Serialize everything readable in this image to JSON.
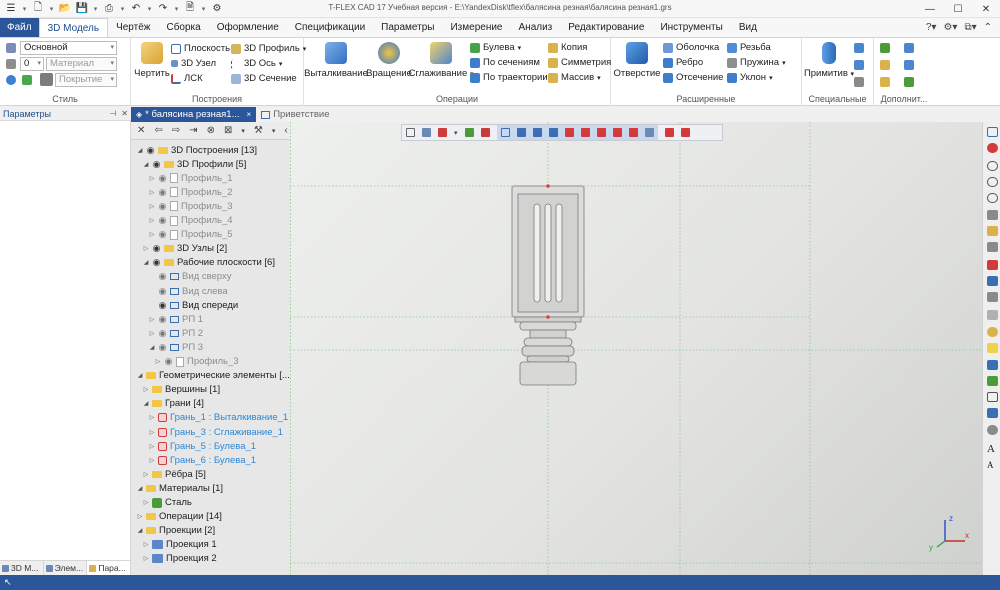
{
  "window": {
    "title": "T-FLEX CAD 17 Учебная версия - E:\\YandexDisk\\tflex\\балясина резная\\балясина резная1.grs",
    "minimize_icon": "minimize-icon",
    "maximize_icon": "maximize-icon",
    "close_icon": "close-icon"
  },
  "quick_access": [
    "menu-icon",
    "new-icon",
    "open-icon",
    "save-icon",
    "print-icon",
    "undo-icon",
    "redo-icon",
    "document-icon",
    "settings-icon"
  ],
  "menu": {
    "file": "Файл",
    "tabs": [
      "3D Модель",
      "Чертёж",
      "Сборка",
      "Оформление",
      "Спецификации",
      "Параметры",
      "Измерение",
      "Анализ",
      "Редактирование",
      "Инструменты",
      "Вид"
    ],
    "active_tab": "3D Модель",
    "right_icons": [
      "help-icon",
      "settings-icon",
      "windows-icon",
      "minimize-ribbon-icon"
    ]
  },
  "ribbon": {
    "style_group": {
      "label": "Стиль",
      "layer_value": "Основной",
      "priority_value": "0",
      "material_placeholder": "Материал",
      "coating_placeholder": "Покрытие"
    },
    "build_group": {
      "label": "Построения",
      "draw": "Чертить",
      "items": [
        "Плоскость",
        "3D Узел",
        "ЛСК",
        "3D Профиль",
        "3D Ось",
        "3D Сечение"
      ]
    },
    "ops_group": {
      "label": "Операции",
      "big": [
        "Выталкивание",
        "Вращение",
        "Сглаживание"
      ],
      "small": [
        "Булева",
        "По сечениям",
        "По траектории",
        "Копия",
        "Симметрия",
        "Массив"
      ]
    },
    "ext_group": {
      "label": "Расширенные",
      "big": "Отверстие",
      "small": [
        "Оболочка",
        "Ребро",
        "Отсечение",
        "Резьба",
        "Пружина",
        "Уклон"
      ]
    },
    "special_group": {
      "label": "Специальные",
      "big": "Примитив"
    },
    "extra_group": {
      "label": "Дополнит..."
    }
  },
  "panel": {
    "title": "Параметры",
    "pin_icon": "pin-icon",
    "close_icon": "close-icon"
  },
  "bottom_tabs": [
    "3D М...",
    "Элем...",
    "Пара..."
  ],
  "doc_tabs": [
    {
      "label": "* балясина резная1...",
      "close": "×"
    },
    {
      "label": "Приветствие"
    }
  ],
  "tree": [
    {
      "label": "3D Построения [13]",
      "style": "normal",
      "icon": "folder"
    },
    {
      "label": "3D Профили [5]",
      "style": "normal",
      "icon": "folder"
    },
    {
      "label": "Профиль_1",
      "style": "gray",
      "icon": "doc"
    },
    {
      "label": "Профиль_2",
      "style": "gray",
      "icon": "doc"
    },
    {
      "label": "Профиль_3",
      "style": "gray",
      "icon": "doc"
    },
    {
      "label": "Профиль_4",
      "style": "gray",
      "icon": "doc"
    },
    {
      "label": "Профиль_5",
      "style": "gray",
      "icon": "doc"
    },
    {
      "label": "3D Узлы [2]",
      "style": "normal",
      "icon": "folder"
    },
    {
      "label": "Рабочие плоскости [6]",
      "style": "normal",
      "icon": "folder"
    },
    {
      "label": "Вид сверху",
      "style": "gray",
      "icon": "plane"
    },
    {
      "label": "Вид слева",
      "style": "gray",
      "icon": "plane"
    },
    {
      "label": "Вид спереди",
      "style": "normal",
      "icon": "plane"
    },
    {
      "label": "РП 1",
      "style": "gray",
      "icon": "plane"
    },
    {
      "label": "РП 2",
      "style": "gray",
      "icon": "plane"
    },
    {
      "label": "РП 3",
      "style": "gray",
      "icon": "plane"
    },
    {
      "label": "Профиль_3",
      "style": "gray",
      "icon": "doc"
    },
    {
      "label": "Геометрические элементы [...",
      "style": "normal",
      "icon": "folder"
    },
    {
      "label": "Вершины [1]",
      "style": "normal",
      "icon": "folder"
    },
    {
      "label": "Грани [4]",
      "style": "normal",
      "icon": "folder"
    },
    {
      "label": "Грань_1 : Выталкивание_1",
      "style": "blue",
      "icon": "face"
    },
    {
      "label": "Грань_3 : Сглаживание_1",
      "style": "blue",
      "icon": "face"
    },
    {
      "label": "Грань_5 : Булева_1",
      "style": "blue",
      "icon": "face"
    },
    {
      "label": "Грань_6 : Булева_1",
      "style": "blue",
      "icon": "face"
    },
    {
      "label": "Рёбра [5]",
      "style": "normal",
      "icon": "folder"
    },
    {
      "label": "Материалы [1]",
      "style": "normal",
      "icon": "folder"
    },
    {
      "label": "Сталь",
      "style": "normal",
      "icon": "mat"
    },
    {
      "label": "Операции [14]",
      "style": "normal",
      "icon": "folder"
    },
    {
      "label": "Проекции [2]",
      "style": "normal",
      "icon": "folder"
    },
    {
      "label": "Проекция 1",
      "style": "normal",
      "icon": "proj"
    },
    {
      "label": "Проекция 2",
      "style": "normal",
      "icon": "proj"
    }
  ],
  "axis_labels": {
    "x": "x",
    "y": "y",
    "z": "z"
  },
  "colors": {
    "accent": "#2b579a",
    "link_blue": "#2e86d6",
    "folder": "#f2c745",
    "model_body": "#d8d8d6",
    "guide_green": "#88c988",
    "marker_red": "#e23b3b"
  }
}
